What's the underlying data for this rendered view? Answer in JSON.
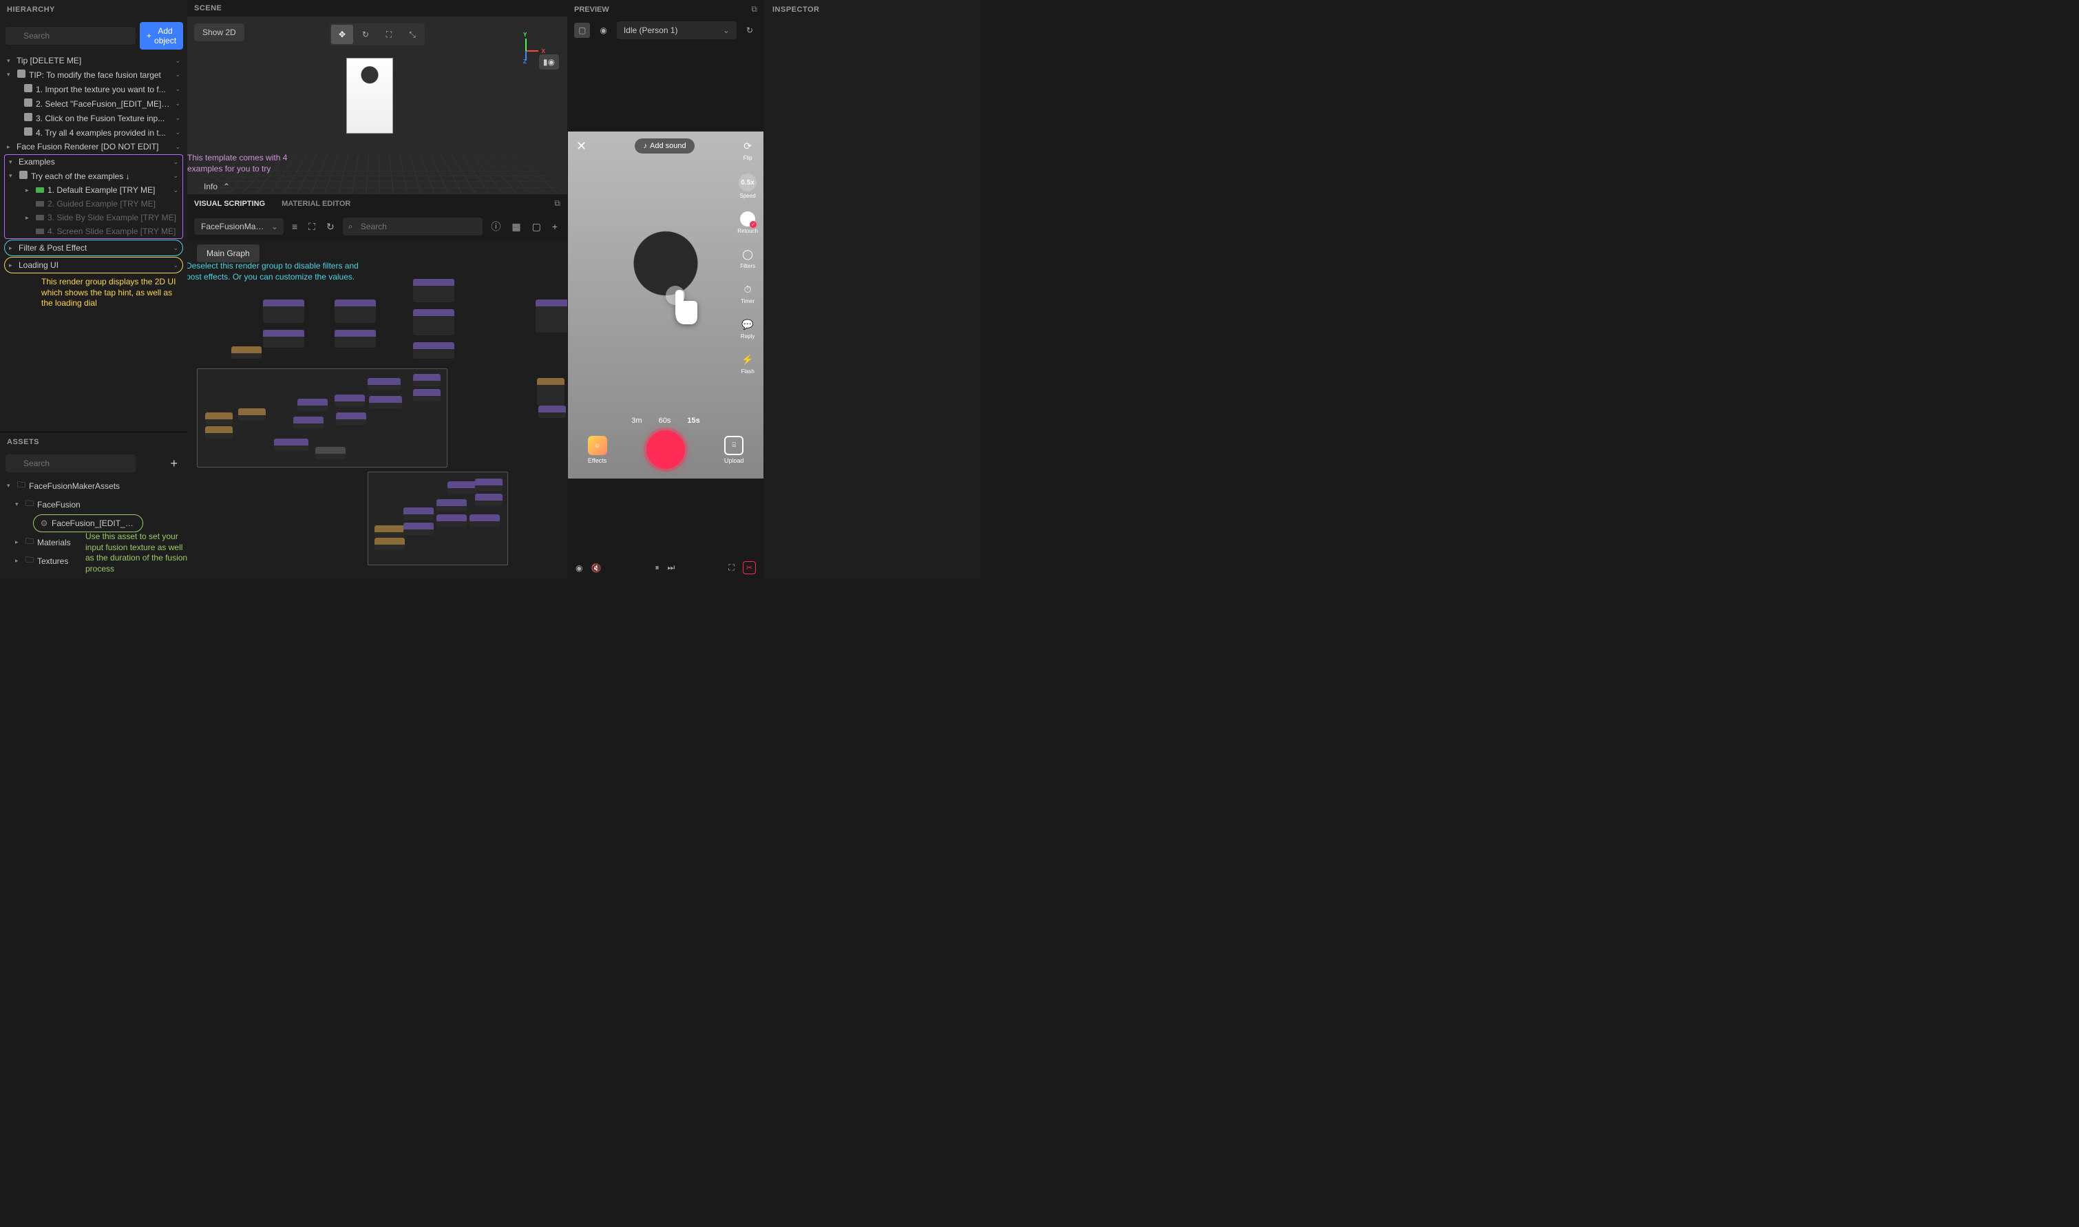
{
  "hierarchy": {
    "title": "HIERARCHY",
    "search_placeholder": "Search",
    "add_object": "Add object",
    "items": {
      "tip_delete": "Tip [DELETE ME]",
      "tip_modify": "TIP: To modify the face fusion target",
      "step1": "1. Import the texture you want to f...",
      "step2": "2. Select \"FaceFusion_[EDIT_ME]\" ...",
      "step3": "3. Click on the Fusion Texture inp...",
      "step4": "4. Try all 4 examples provided in t...",
      "renderer": "Face Fusion Renderer [DO NOT EDIT]",
      "examples": "Examples",
      "try_each": "Try each of the examples ↓",
      "ex1": "1. Default Example [TRY ME]",
      "ex2": "2. Guided Example [TRY ME]",
      "ex3": "3. Side By Side Example [TRY ME]",
      "ex4": "4. Screen Slide Example [TRY ME]",
      "filter": "Filter & Post Effect",
      "loading": "Loading UI"
    }
  },
  "annotations": {
    "purple": "This template comes with 4 examples for you to try",
    "cyan": "Deselect this render group to disable filters and post effects. Or you can customize the values.",
    "yellow": "This render group displays the 2D UI which shows the tap hint, as well as the loading dial",
    "green": "Use this asset to set your input fusion texture as well as the duration of the fusion process"
  },
  "assets": {
    "title": "ASSETS",
    "search_placeholder": "Search",
    "items": {
      "root": "FaceFusionMakerAssets",
      "ff": "FaceFusion",
      "edit": "FaceFusion_[EDIT_ME]",
      "materials": "Materials",
      "textures": "Textures"
    }
  },
  "scene": {
    "title": "SCENE",
    "show2d": "Show 2D",
    "info": "Info",
    "axes": {
      "x": "X",
      "y": "Y",
      "z": "Z"
    }
  },
  "vs": {
    "tab_vs": "VISUAL SCRIPTING",
    "tab_me": "MATERIAL EDITOR",
    "asset": "FaceFusionMakerAs...",
    "search_placeholder": "Search",
    "main_graph": "Main Graph"
  },
  "preview": {
    "title": "PREVIEW",
    "state": "Idle (Person 1)",
    "add_sound": "Add sound",
    "side": {
      "flip": "Flip",
      "speed_val": "0.5x",
      "speed": "Speed",
      "retouch": "Retouch",
      "filters": "Filters",
      "timer": "Timer",
      "reply": "Reply",
      "flash": "Flash"
    },
    "durations": {
      "d1": "3m",
      "d2": "60s",
      "d3": "15s"
    },
    "effects": "Effects",
    "upload": "Upload"
  },
  "inspector": {
    "title": "INSPECTOR"
  }
}
